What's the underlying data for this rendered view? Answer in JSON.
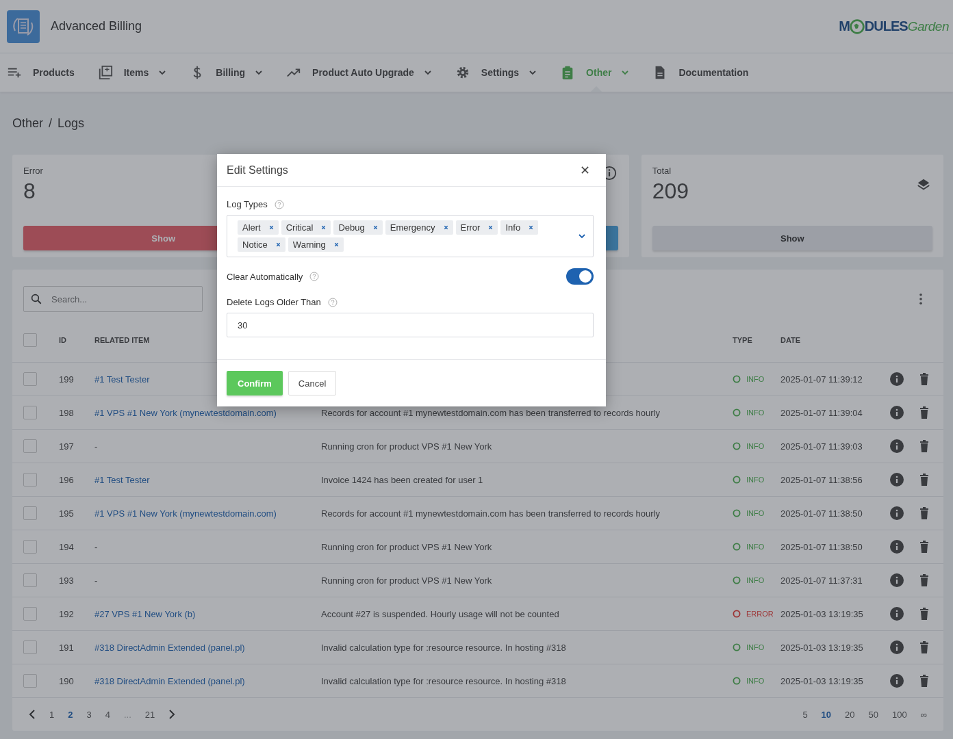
{
  "app": {
    "title": "Advanced Billing",
    "logo": {
      "prefix": "M",
      "main": "DULES",
      "suffix": "Garden"
    }
  },
  "nav": [
    {
      "label": "Products",
      "dropdown": false,
      "selected": false
    },
    {
      "label": "Items",
      "dropdown": true,
      "selected": false
    },
    {
      "label": "Billing",
      "dropdown": true,
      "selected": false
    },
    {
      "label": "Product Auto Upgrade",
      "dropdown": true,
      "selected": false
    },
    {
      "label": "Settings",
      "dropdown": true,
      "selected": false
    },
    {
      "label": "Other",
      "dropdown": true,
      "selected": true
    },
    {
      "label": "Documentation",
      "dropdown": false,
      "selected": false
    }
  ],
  "breadcrumb": {
    "items": [
      "Other",
      "Logs"
    ],
    "separator": "/"
  },
  "stats": [
    {
      "kind": "error",
      "label": "Error",
      "value": "8",
      "button": "Show"
    },
    {
      "kind": "info"
    },
    {
      "kind": "total",
      "label": "Total",
      "value": "209",
      "button": "Show"
    }
  ],
  "search": {
    "placeholder": "Search..."
  },
  "table": {
    "select_all_checked": false,
    "columns": [
      "ID",
      "RELATED ITEM",
      "",
      "TYPE",
      "DATE"
    ],
    "rows": [
      {
        "checked": false,
        "id": "199",
        "item": "#1 Test Tester",
        "type": "INFO",
        "kind": "info",
        "date": "2025-01-07 11:39:12"
      },
      {
        "checked": false,
        "id": "198",
        "item": "#1 VPS #1 New York (mynewtestdomain.com)",
        "message": "Records for account #1 mynewtestdomain.com has been transferred to records hourly",
        "type": "INFO",
        "kind": "info",
        "date": "2025-01-07 11:39:04"
      },
      {
        "checked": false,
        "id": "197",
        "item": "-",
        "message": "Running cron for product VPS #1 New York",
        "type": "INFO",
        "kind": "info",
        "date": "2025-01-07 11:39:03"
      },
      {
        "checked": false,
        "id": "196",
        "item": "#1 Test Tester",
        "message": "Invoice 1424 has been created for user 1",
        "type": "INFO",
        "kind": "info",
        "date": "2025-01-07 11:38:56"
      },
      {
        "checked": false,
        "id": "195",
        "item": "#1 VPS #1 New York (mynewtestdomain.com)",
        "message": "Records for account #1 mynewtestdomain.com has been transferred to records hourly",
        "type": "INFO",
        "kind": "info",
        "date": "2025-01-07 11:38:50"
      },
      {
        "checked": false,
        "id": "194",
        "item": "-",
        "message": "Running cron for product VPS #1 New York",
        "type": "INFO",
        "kind": "info",
        "date": "2025-01-07 11:38:50"
      },
      {
        "checked": false,
        "id": "193",
        "item": "-",
        "message": "Running cron for product VPS #1 New York",
        "type": "INFO",
        "kind": "info",
        "date": "2025-01-07 11:37:31"
      },
      {
        "checked": false,
        "id": "192",
        "item": "#27 VPS #1 New York (b)",
        "message": "Account #27 is suspended. Hourly usage will not be counted",
        "type": "ERROR",
        "kind": "error",
        "date": "2025-01-03 13:19:35"
      },
      {
        "checked": false,
        "id": "191",
        "item": "#318 DirectAdmin Extended (panel.pl)",
        "message": "Invalid calculation type for :resource resource. In hosting #318",
        "type": "INFO",
        "kind": "info",
        "date": "2025-01-03 13:19:35"
      },
      {
        "checked": false,
        "id": "190",
        "item": "#318 DirectAdmin Extended (panel.pl)",
        "message": "Invalid calculation type for :resource resource. In hosting #318",
        "type": "INFO",
        "kind": "info",
        "date": "2025-01-03 13:19:35"
      }
    ]
  },
  "pagination": {
    "pages": [
      {
        "label": "1",
        "selected": false
      },
      {
        "label": "2",
        "selected": true
      },
      {
        "label": "3",
        "selected": false
      },
      {
        "label": "4",
        "selected": false
      },
      {
        "label": "...",
        "selected": false
      },
      {
        "label": "21",
        "selected": false
      }
    ],
    "per_page": [
      {
        "label": "5",
        "selected": false
      },
      {
        "label": "10",
        "selected": true
      },
      {
        "label": "20",
        "selected": false
      },
      {
        "label": "50",
        "selected": false
      },
      {
        "label": "100",
        "selected": false
      },
      {
        "label": "∞",
        "selected": false
      }
    ]
  },
  "modal": {
    "title": "Edit Settings",
    "log_types": {
      "label": "Log Types",
      "tags": [
        "Alert",
        "Critical",
        "Debug",
        "Emergency",
        "Error",
        "Info",
        "Notice",
        "Warning"
      ]
    },
    "clear": {
      "label": "Clear Automatically",
      "on": true
    },
    "older": {
      "label": "Delete Logs Older Than",
      "value": "30"
    },
    "confirm": "Confirm",
    "cancel": "Cancel"
  }
}
